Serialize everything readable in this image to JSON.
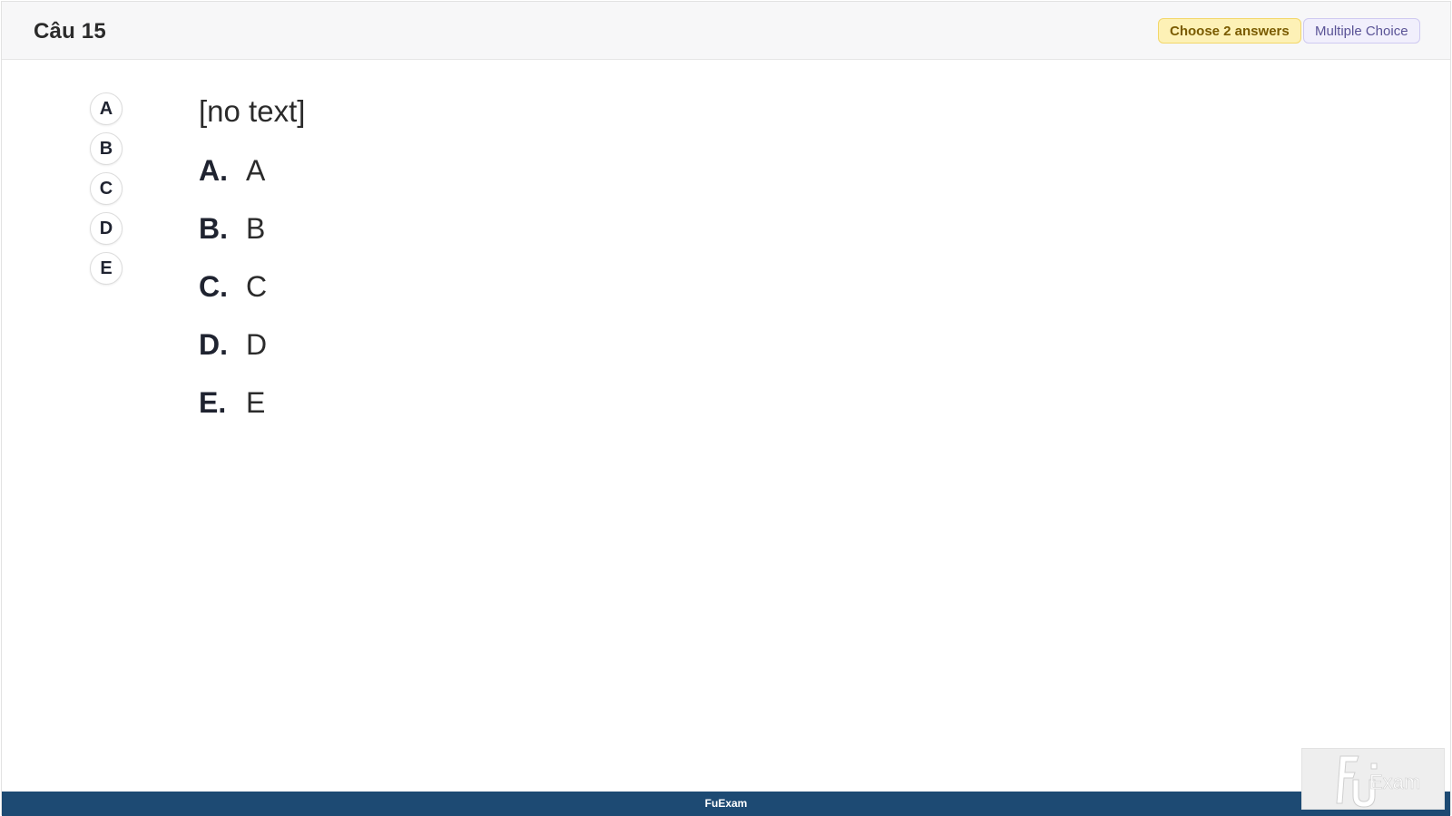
{
  "header": {
    "title": "Câu 15",
    "badges": {
      "choose": "Choose 2 answers",
      "type": "Multiple Choice"
    }
  },
  "selectors": [
    "A",
    "B",
    "C",
    "D",
    "E"
  ],
  "question": {
    "text": "[no text]",
    "options": [
      {
        "letter": "A.",
        "text": "A"
      },
      {
        "letter": "B.",
        "text": "B"
      },
      {
        "letter": "C.",
        "text": "C"
      },
      {
        "letter": "D.",
        "text": "D"
      },
      {
        "letter": "E.",
        "text": "E"
      }
    ]
  },
  "footer": {
    "brand": "FuExam"
  },
  "watermark": {
    "text": "FUExam"
  },
  "colors": {
    "header_bg": "#f7f7f8",
    "footer_bg": "#1d4a73",
    "badge_choose_bg": "#fdf1b6",
    "badge_type_bg": "#f1effc"
  }
}
